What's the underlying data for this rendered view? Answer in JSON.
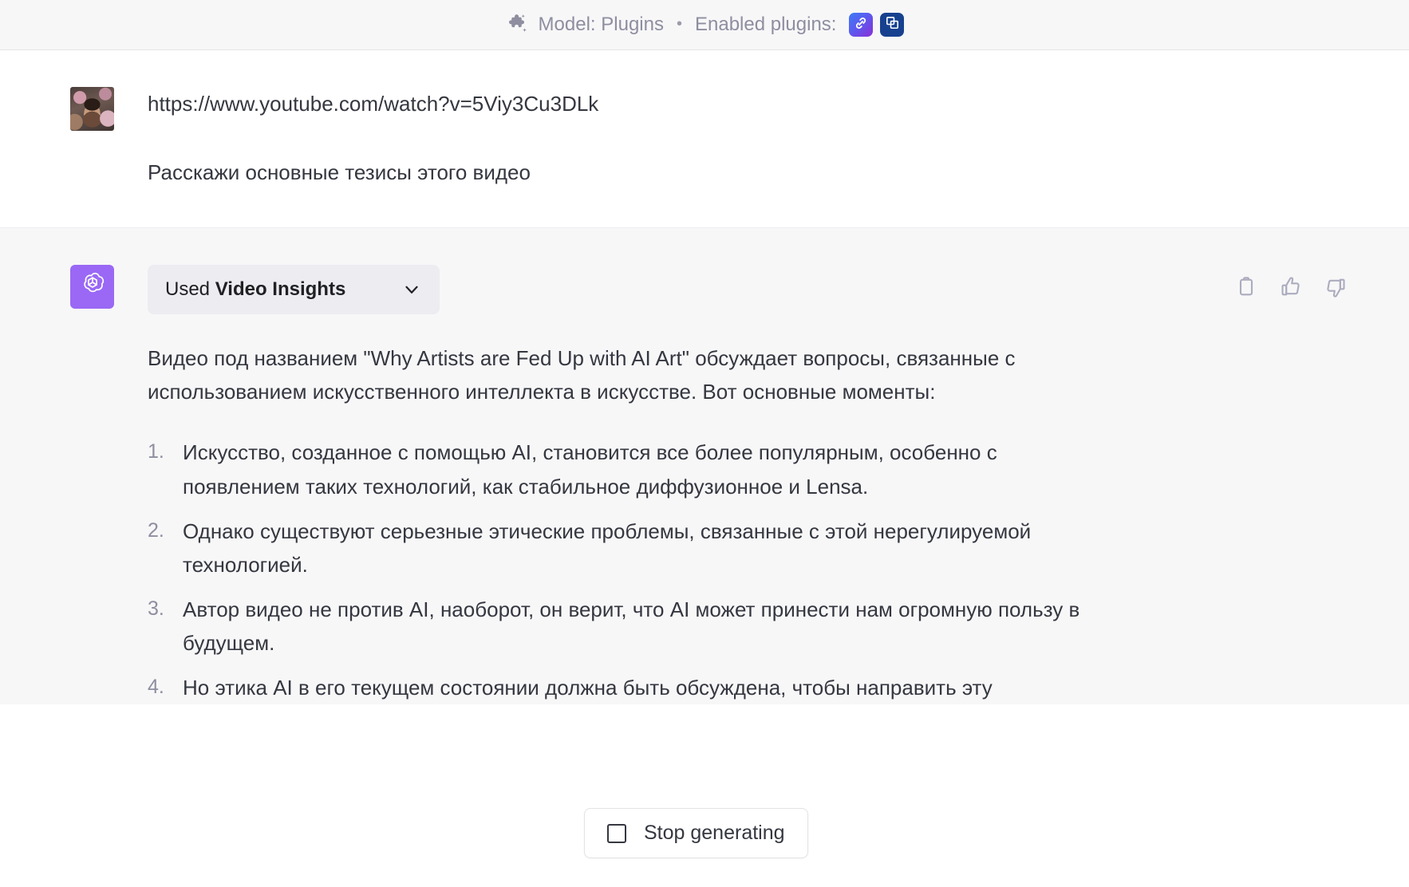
{
  "topbar": {
    "model_label": "Model: Plugins",
    "separator": "•",
    "enabled_plugins_label": "Enabled plugins:",
    "puzzle_icon": "puzzle-icon",
    "plugins": [
      {
        "name": "video-insights-plugin",
        "icon": "link-chain-icon",
        "color": "#5b5bf0"
      },
      {
        "name": "doc-plugin",
        "icon": "layered-squares-icon",
        "color": "#17418f"
      }
    ]
  },
  "user_message": {
    "avatar": "user-avatar-photo",
    "lines": [
      "https://www.youtube.com/watch?v=5Viy3Cu3DLk",
      "Расскажи основные тезисы этого видео"
    ]
  },
  "assistant_message": {
    "avatar": "openai-logo",
    "avatar_color": "#9a68f5",
    "plugin_pill": {
      "prefix": "Used",
      "plugin_name": "Video Insights",
      "chevron": "chevron-down-icon"
    },
    "intro": "Видео под названием \"Why Artists are Fed Up with AI Art\" обсуждает вопросы, связанные с использованием искусственного интеллекта в искусстве. Вот основные моменты:",
    "list": [
      "Искусство, созданное с помощью AI, становится все более популярным, особенно с появлением таких технологий, как стабильное диффузионное и Lensa.",
      "Однако существуют серьезные этические проблемы, связанные с этой нерегулируемой технологией.",
      "Автор видео не против AI, наоборот, он верит, что AI может принести нам огромную пользу в будущем.",
      "Но этика AI в его текущем состоянии должна быть обсуждена, чтобы направить эту"
    ],
    "actions": [
      {
        "name": "copy-button",
        "icon": "clipboard-icon"
      },
      {
        "name": "thumbs-up-button",
        "icon": "thumbs-up-icon"
      },
      {
        "name": "thumbs-down-button",
        "icon": "thumbs-down-icon"
      }
    ]
  },
  "stop_generating": {
    "label": "Stop generating",
    "icon": "stop-square-icon"
  }
}
